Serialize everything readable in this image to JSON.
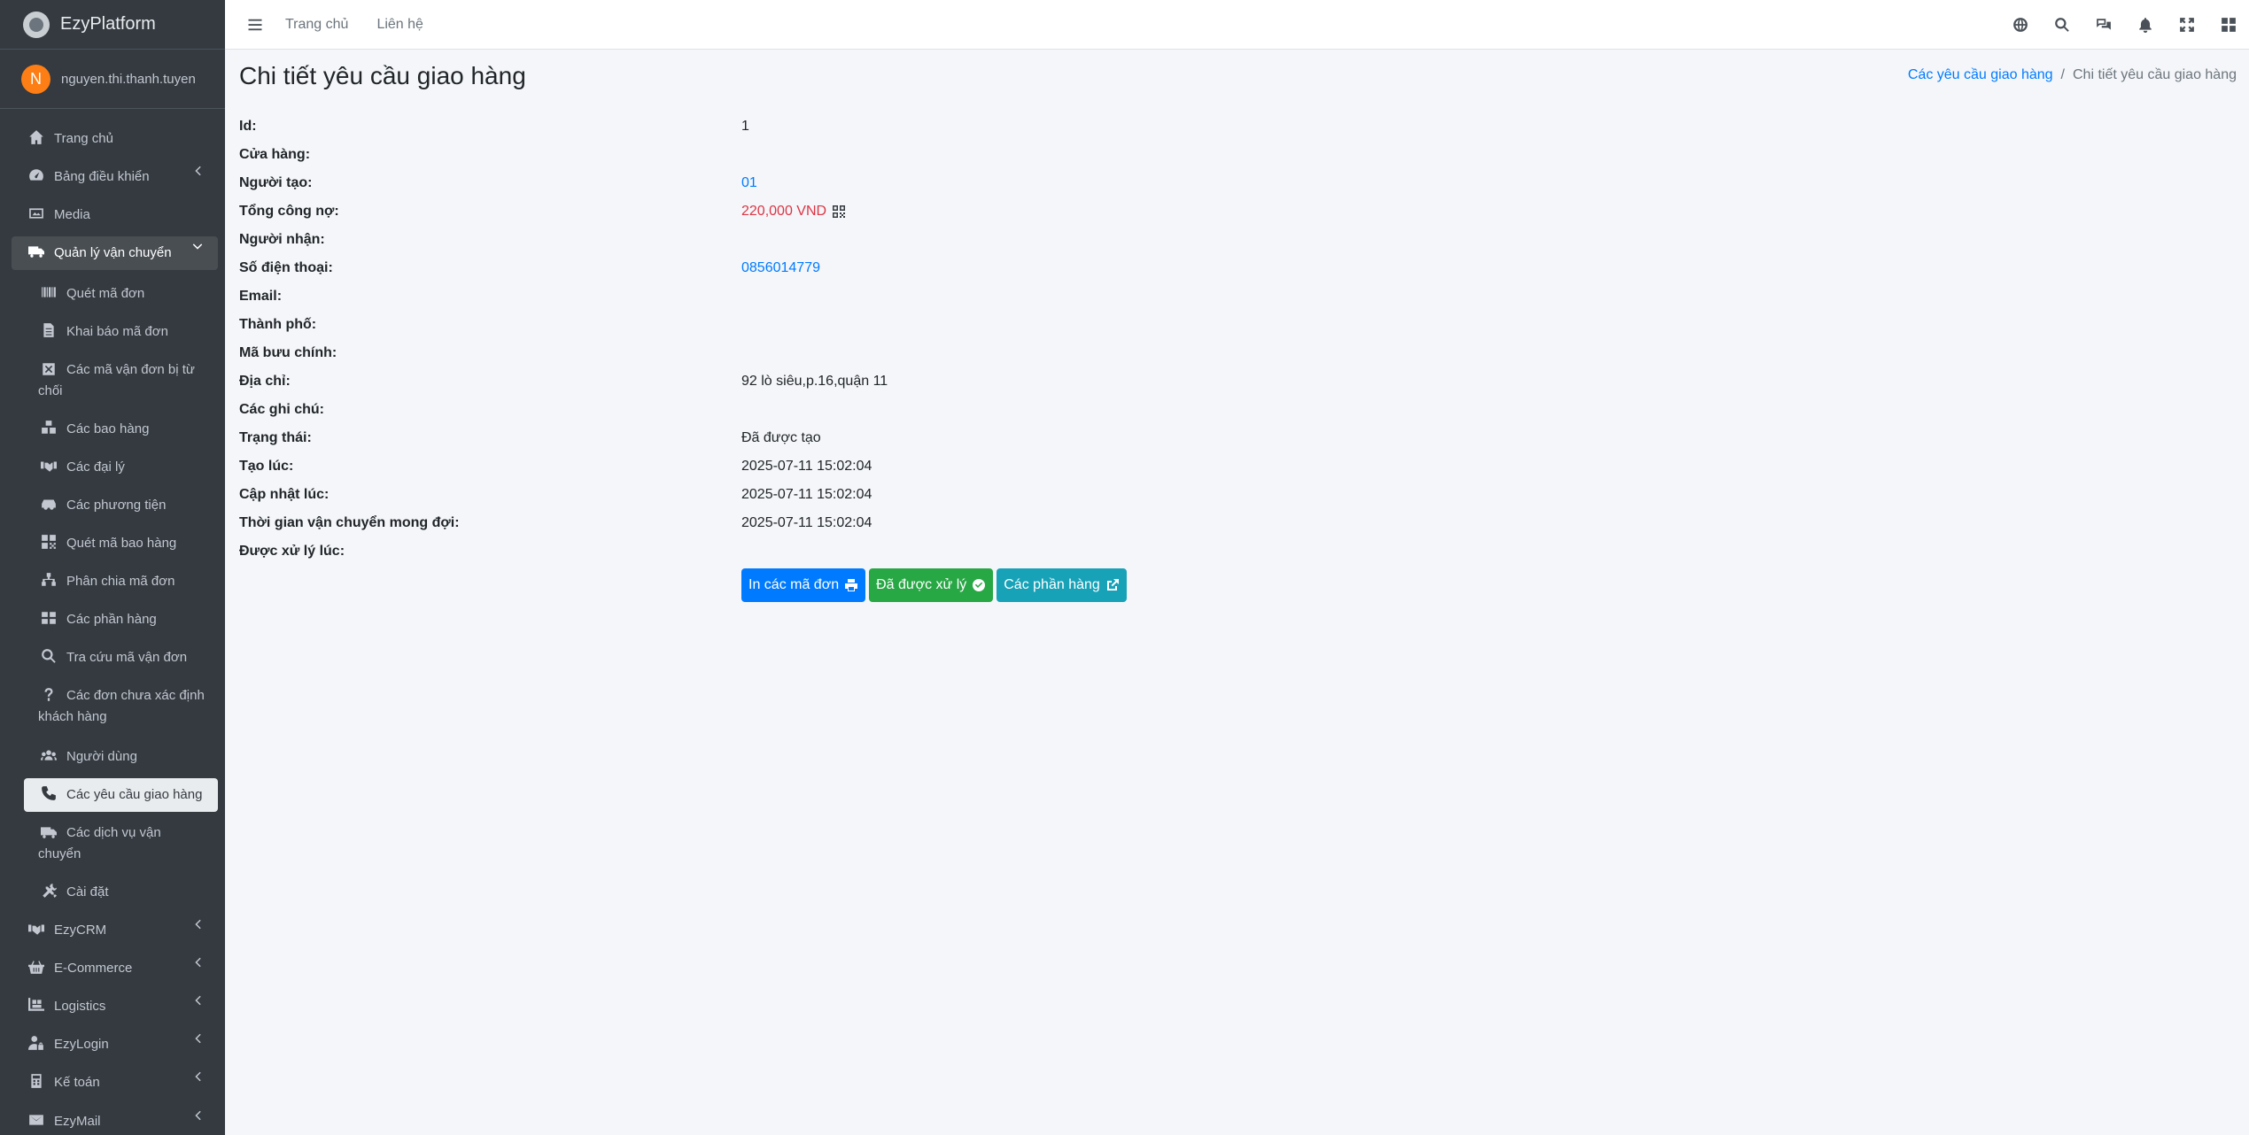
{
  "brand": {
    "name": "EzyPlatform"
  },
  "user": {
    "initial": "N",
    "name": "nguyen.thi.thanh.tuyen"
  },
  "sidebar": {
    "home": "Trang chủ",
    "dashboard": "Bảng điều khiển",
    "media": "Media",
    "shipping": "Quản lý vận chuyển",
    "sub": {
      "scan_order": "Quét mã đơn",
      "declare_order": "Khai báo mã đơn",
      "rejected_orders": "Các mã vận đơn bị từ chối",
      "packages": "Các bao hàng",
      "agents": "Các đại lý",
      "vehicles": "Các phương tiện",
      "scan_package": "Quét mã bao hàng",
      "split_order": "Phân chia mã đơn",
      "sections": "Các phần hàng",
      "lookup": "Tra cứu mã vận đơn",
      "unknown_customers": "Các đơn chưa xác định khách hàng",
      "users": "Người dùng",
      "delivery_requests": "Các yêu cầu giao hàng",
      "shipping_services": "Các dịch vụ vận chuyển",
      "settings": "Cài đặt"
    },
    "ezycrm": "EzyCRM",
    "ecommerce": "E-Commerce",
    "logistics": "Logistics",
    "ezylogin": "EzyLogin",
    "accounting": "Kế toán",
    "ezymail": "EzyMail"
  },
  "topbar": {
    "home": "Trang chủ",
    "contact": "Liên hệ"
  },
  "page": {
    "title": "Chi tiết yêu cầu giao hàng",
    "breadcrumb": {
      "parent": "Các yêu cầu giao hàng",
      "current": "Chi tiết yêu cầu giao hàng"
    }
  },
  "details": {
    "id": {
      "label": "Id:",
      "value": "1"
    },
    "store": {
      "label": "Cửa hàng:",
      "value": ""
    },
    "creator": {
      "label": "Người tạo:",
      "value": "01"
    },
    "total_debt": {
      "label": "Tổng công nợ:",
      "value": "220,000 VND"
    },
    "receiver": {
      "label": "Người nhận:",
      "value": ""
    },
    "phone": {
      "label": "Số điện thoại:",
      "value": "0856014779"
    },
    "email": {
      "label": "Email:",
      "value": ""
    },
    "city": {
      "label": "Thành phố:",
      "value": ""
    },
    "postal_code": {
      "label": "Mã bưu chính:",
      "value": ""
    },
    "address": {
      "label": "Địa chỉ:",
      "value": "92 lò siêu,p.16,quận 11"
    },
    "notes": {
      "label": "Các ghi chú:",
      "value": ""
    },
    "status": {
      "label": "Trạng thái:",
      "value": "Đã được tạo"
    },
    "created_at": {
      "label": "Tạo lúc:",
      "value": "2025-07-11 15:02:04"
    },
    "updated_at": {
      "label": "Cập nhật lúc:",
      "value": "2025-07-11 15:02:04"
    },
    "expected_time": {
      "label": "Thời gian vận chuyển mong đợi:",
      "value": "2025-07-11 15:02:04"
    },
    "processed_at": {
      "label": "Được xử lý lúc:",
      "value": ""
    }
  },
  "actions": {
    "print": "In các mã đơn",
    "processed": "Đã được xử lý",
    "sections": "Các phần hàng"
  },
  "colors": {
    "primary": "#007bff",
    "success": "#28a745",
    "info": "#17a2b8",
    "danger": "#dc3545",
    "sidebar": "#343a40"
  }
}
